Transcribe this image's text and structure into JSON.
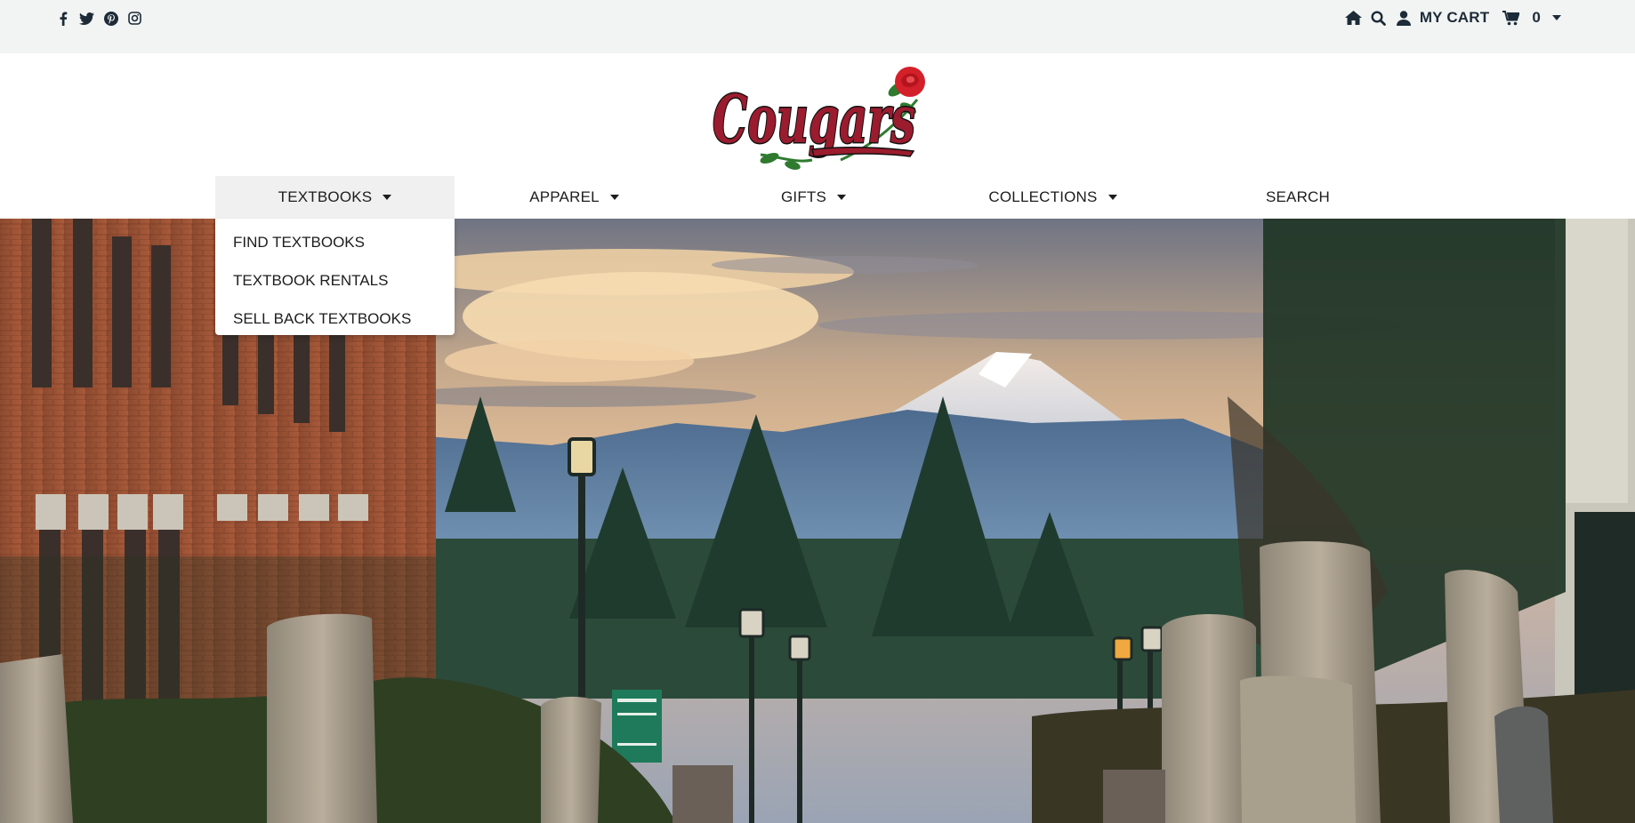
{
  "topbar": {
    "social": [
      {
        "icon": "facebook-icon",
        "glyph": "f"
      },
      {
        "icon": "twitter-icon",
        "glyph": ""
      },
      {
        "icon": "pinterest-icon",
        "glyph": "p"
      },
      {
        "icon": "instagram-icon",
        "glyph": ""
      }
    ],
    "home_icon": "home-icon",
    "search_icon": "search-icon",
    "user_icon": "user-icon",
    "cart_label": "MY CART",
    "cart_icon": "cart-icon",
    "cart_count": "0",
    "cart_dropdown_icon": "chevron-down-icon"
  },
  "logo": {
    "text": "Cougars",
    "brand_color": "#9b1c2e",
    "rose_color": "#d4202a",
    "leaf_color": "#2f7a2f"
  },
  "nav": {
    "items": [
      {
        "label": "TEXTBOOKS",
        "has_caret": true,
        "active": true
      },
      {
        "label": "APPAREL",
        "has_caret": true,
        "active": false
      },
      {
        "label": "GIFTS",
        "has_caret": true,
        "active": false
      },
      {
        "label": "COLLECTIONS",
        "has_caret": true,
        "active": false
      },
      {
        "label": "SEARCH",
        "has_caret": false,
        "active": false
      }
    ]
  },
  "dropdown": {
    "items": [
      {
        "label": "FIND TEXTBOOKS"
      },
      {
        "label": "TEXTBOOK RENTALS"
      },
      {
        "label": "SELL BACK TEXTBOOKS"
      }
    ]
  },
  "colors": {
    "topbar_bg": "#f2f4f3",
    "icon_color": "#1d2b38",
    "nav_active_bg": "#f0f0f0"
  }
}
